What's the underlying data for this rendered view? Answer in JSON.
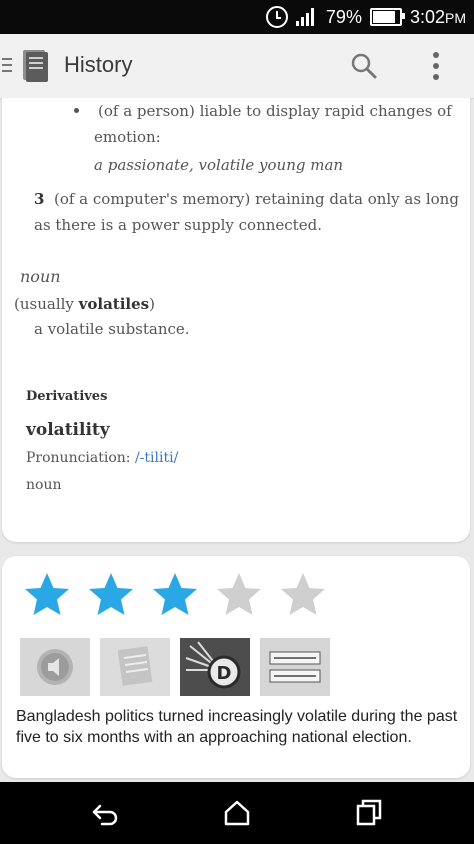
{
  "status_bar": {
    "battery_percent": "79%",
    "time": "3:02",
    "time_suffix": "PM"
  },
  "app_bar": {
    "title": "History"
  },
  "definition": {
    "sense_2b_text_line1": "(of a person) liable to display rapid changes of",
    "sense_2b_text_line2": "emotion:",
    "sense_2b_example": "a passionate, volatile young man",
    "sense_3_number": "3",
    "sense_3_text_line1": "(of a computer's memory) retaining data only as long",
    "sense_3_text_line2": "as there is a power supply connected.",
    "noun_label": "noun",
    "noun_qualifier_open": "(usually ",
    "noun_qualifier_word": "volatiles",
    "noun_qualifier_close": ")",
    "noun_definition": "a volatile substance.",
    "derivatives_heading": "Derivatives",
    "derivative_word": "volatility",
    "pronunciation_label": "Pronunciation: ",
    "pronunciation_value": "/-tiliti/",
    "derivative_pos": "noun"
  },
  "rating": {
    "value": 3,
    "max": 5,
    "filled_color": "#2aa8e6",
    "empty_color": "#cfcfcf"
  },
  "thumbnails": [
    {
      "icon": "speaker-icon"
    },
    {
      "icon": "notepad-icon"
    },
    {
      "icon": "dictionary-logo-icon"
    },
    {
      "icon": "word-card-icon"
    }
  ],
  "caption": "Bangladesh politics turned increasingly volatile during the past five to six months with an approaching national election."
}
